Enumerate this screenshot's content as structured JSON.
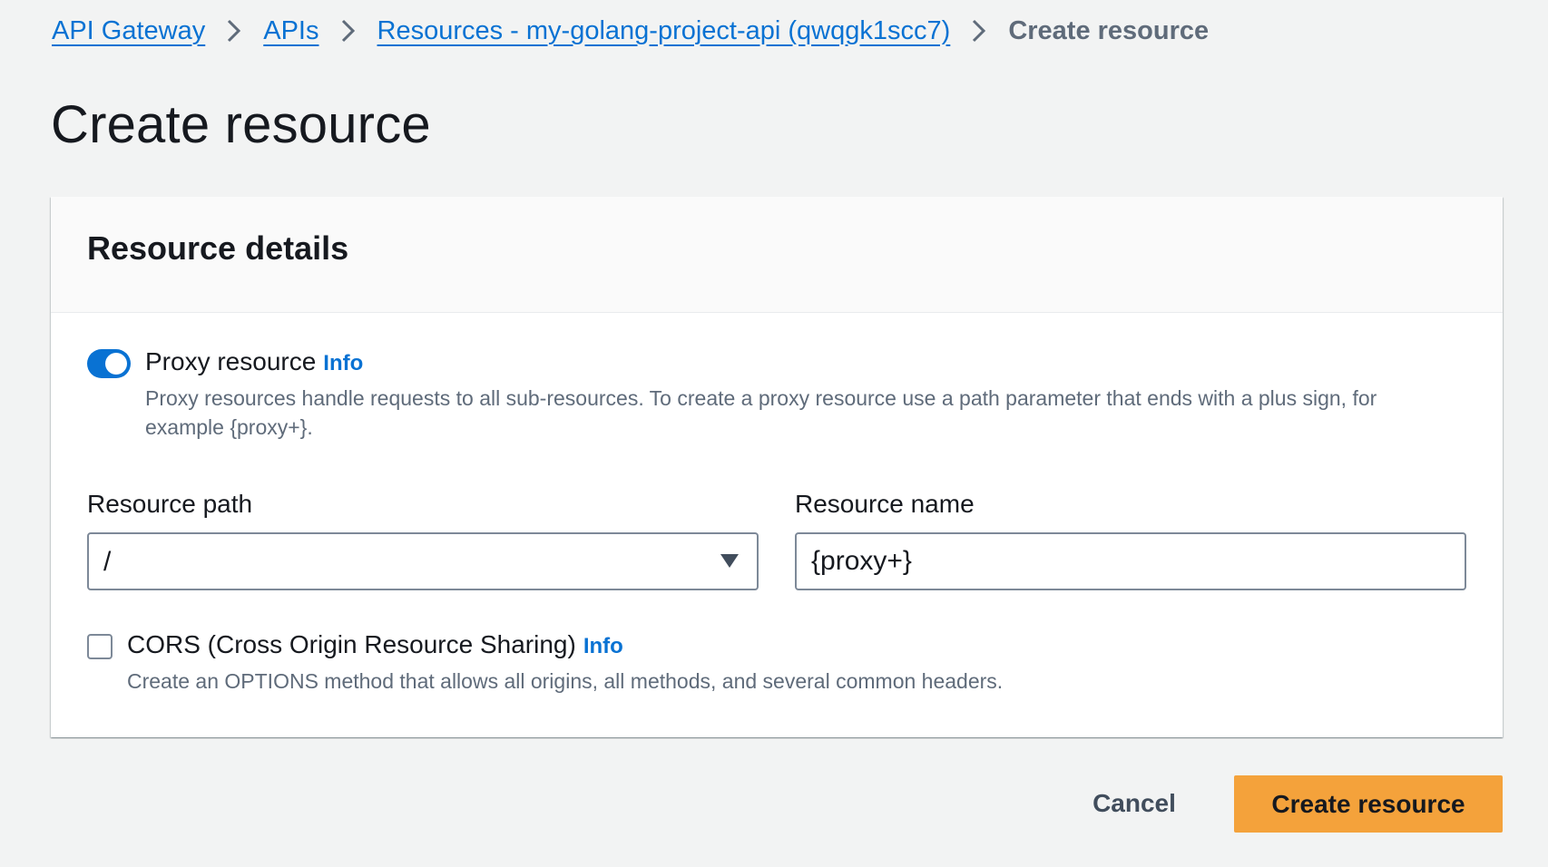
{
  "breadcrumb": {
    "items": [
      {
        "label": "API Gateway"
      },
      {
        "label": "APIs"
      },
      {
        "label": "Resources - my-golang-project-api (qwqgk1scc7)"
      }
    ],
    "current": "Create resource"
  },
  "page": {
    "title": "Create resource"
  },
  "resource_details": {
    "title": "Resource details",
    "proxy": {
      "label": "Proxy resource",
      "info": "Info",
      "enabled": true,
      "description": "Proxy resources handle requests to all sub-resources. To create a proxy resource use a path parameter that ends with a plus sign, for example {proxy+}."
    },
    "resource_path": {
      "label": "Resource path",
      "value": "/"
    },
    "resource_name": {
      "label": "Resource name",
      "value": "{proxy+}"
    },
    "cors": {
      "label": "CORS (Cross Origin Resource Sharing)",
      "info": "Info",
      "checked": false,
      "description": "Create an OPTIONS method that allows all origins, all methods, and several common headers."
    }
  },
  "actions": {
    "cancel_label": "Cancel",
    "submit_label": "Create resource"
  },
  "colors": {
    "link": "#0972d3",
    "primary_button": "#f4a23b",
    "background": "#f2f3f3"
  },
  "icons": {
    "separator": "chevron-right-icon",
    "select_caret": "caret-down-icon"
  }
}
